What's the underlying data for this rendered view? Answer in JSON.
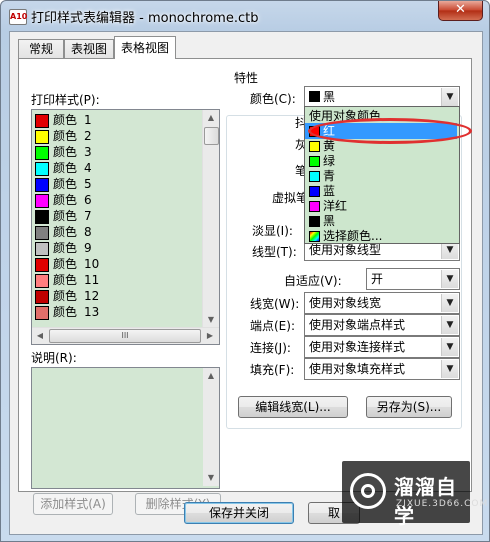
{
  "window": {
    "title": "打印样式表编辑器 - monochrome.ctb",
    "close": "✕",
    "app_icon": "A10"
  },
  "tabs": [
    {
      "label": "常规"
    },
    {
      "label": "表视图"
    },
    {
      "label": "表格视图"
    }
  ],
  "left": {
    "print_styles_label": "打印样式(P):",
    "styles": [
      {
        "name": "颜色",
        "num": "1",
        "color": "#e00000"
      },
      {
        "name": "颜色",
        "num": "2",
        "color": "#ffff00"
      },
      {
        "name": "颜色",
        "num": "3",
        "color": "#00ff00"
      },
      {
        "name": "颜色",
        "num": "4",
        "color": "#00ffff"
      },
      {
        "name": "颜色",
        "num": "5",
        "color": "#0000ff"
      },
      {
        "name": "颜色",
        "num": "6",
        "color": "#ff00ff"
      },
      {
        "name": "颜色",
        "num": "7",
        "color": "#000000"
      },
      {
        "name": "颜色",
        "num": "8",
        "color": "#808080"
      },
      {
        "name": "颜色",
        "num": "9",
        "color": "#c0c0c0"
      },
      {
        "name": "颜色",
        "num": "10",
        "color": "#e00000"
      },
      {
        "name": "颜色",
        "num": "11",
        "color": "#ff7f7f"
      },
      {
        "name": "颜色",
        "num": "12",
        "color": "#c00000"
      },
      {
        "name": "颜色",
        "num": "13",
        "color": "#e0706a"
      }
    ],
    "hscroll_glyph": "III",
    "description_label": "说明(R):",
    "add_style": "添加样式(A)",
    "delete_style": "删除样式(Y)"
  },
  "properties": {
    "group_label": "特性",
    "color_label": "颜色(C):",
    "color_value": "黑",
    "dither_label": "抖",
    "grayscale_label": "灰",
    "pen_label": "笔",
    "virtual_pen_label": "虚拟笔",
    "screening_label": "淡显(I):",
    "linetype_label": "线型(T):",
    "linetype_value": "使用对象线型",
    "adaptive_label": "自适应(V):",
    "adaptive_value": "开",
    "lineweight_label": "线宽(W):",
    "lineweight_value": "使用对象线宽",
    "endstyle_label": "端点(E):",
    "endstyle_value": "使用对象端点样式",
    "joinstyle_label": "连接(J):",
    "joinstyle_value": "使用对象连接样式",
    "fillstyle_label": "填充(F):",
    "fillstyle_value": "使用对象填充样式",
    "edit_lineweights": "编辑线宽(L)...",
    "save_as": "另存为(S)..."
  },
  "color_dropdown": {
    "items": [
      {
        "label": "使用对象颜色",
        "color": ""
      },
      {
        "label": "红",
        "color": "#ff0000"
      },
      {
        "label": "黄",
        "color": "#ffff00"
      },
      {
        "label": "绿",
        "color": "#00ff00"
      },
      {
        "label": "青",
        "color": "#00ffff"
      },
      {
        "label": "蓝",
        "color": "#0000ff"
      },
      {
        "label": "洋红",
        "color": "#ff00ff"
      },
      {
        "label": "黑",
        "color": "#000000"
      },
      {
        "label": "选择颜色...",
        "color": ""
      }
    ],
    "selected_index": 1
  },
  "footer": {
    "save_close": "保存并关闭",
    "cancel": "取"
  },
  "watermark": {
    "text": "溜溜自学",
    "sub": "ZIXUE.3D66.COM"
  }
}
